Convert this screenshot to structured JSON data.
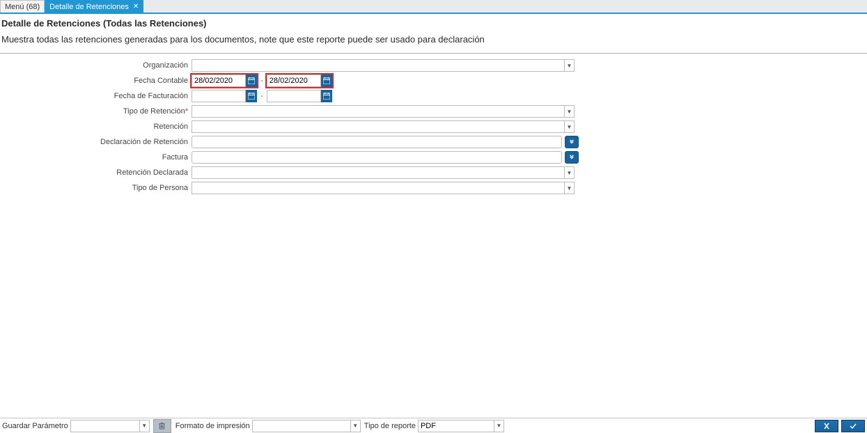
{
  "tabs": {
    "menu": "Menú (68)",
    "active": "Detalle de Retenciones"
  },
  "header": {
    "title": "Detalle de Retenciones (Todas las Retenciones)",
    "subtitle": "Muestra todas las retenciones generadas para los documentos, note que este reporte puede ser usado para declaración"
  },
  "form": {
    "labels": {
      "organizacion": "Organización",
      "fecha_contable": "Fecha Contable",
      "fecha_facturacion": "Fecha de Facturación",
      "tipo_retencion": "Tipo de Retención",
      "retencion": "Retención",
      "declaracion_retencion": "Declaración de Retención",
      "factura": "Factura",
      "retencion_declarada": "Retención Declarada",
      "tipo_persona": "Tipo de Persona"
    },
    "values": {
      "organizacion": "",
      "fecha_contable_from": "28/02/2020",
      "fecha_contable_to": "28/02/2020",
      "fecha_facturacion_from": "",
      "fecha_facturacion_to": "",
      "tipo_retencion": "",
      "retencion": "",
      "declaracion_retencion": "",
      "factura": "",
      "retencion_declarada": "",
      "tipo_persona": ""
    }
  },
  "bottom": {
    "guardar_parametro_label": "Guardar Parámetro",
    "guardar_parametro_value": "",
    "formato_impresion_label": "Formato de impresión",
    "formato_impresion_value": "",
    "tipo_reporte_label": "Tipo de reporte",
    "tipo_reporte_value": "PDF"
  }
}
